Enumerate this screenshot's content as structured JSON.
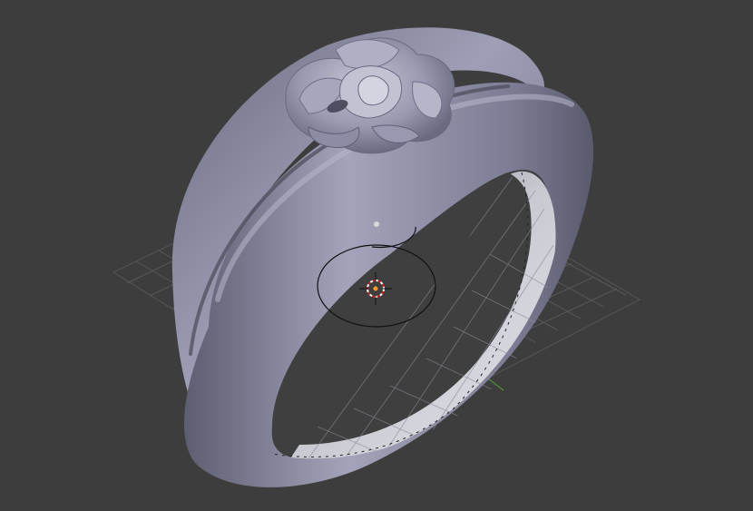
{
  "viewport": {
    "background": "#3d3d3d",
    "grid_color": "#5a5a5a",
    "x_axis_color": "#a33a3a",
    "y_axis_color": "#4e8f3a",
    "model_color": "#8e8ea6"
  },
  "scene": {
    "model": "ring-with-rose",
    "icons": [
      "3d-cursor-icon",
      "empty-object-icon",
      "light-origin-icon",
      "circle-gizmo-icon"
    ]
  }
}
